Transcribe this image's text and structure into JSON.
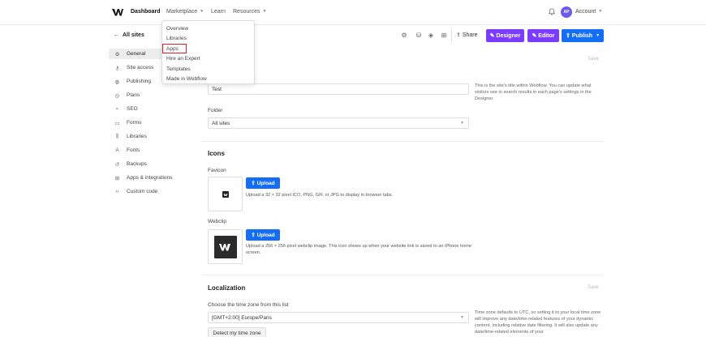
{
  "topnav": {
    "items": [
      {
        "label": "Dashboard",
        "active": true
      },
      {
        "label": "Marketplace",
        "has_caret": true
      },
      {
        "label": "Learn"
      },
      {
        "label": "Resources",
        "has_caret": true
      }
    ],
    "avatar_initials": "AP",
    "account_label": "Account"
  },
  "dropdown": {
    "items": [
      "Overview",
      "Libraries",
      "Apps",
      "Hire an Expert",
      "Templates",
      "Made in Webflow"
    ],
    "highlighted": "Apps",
    "highlight_color": "#d8242a"
  },
  "sidebar": {
    "back_label": "All sites",
    "items": [
      {
        "label": "General",
        "icon": "gear-icon",
        "active": true
      },
      {
        "label": "Site access",
        "icon": "key-icon"
      },
      {
        "label": "Publishing",
        "icon": "globe-icon"
      },
      {
        "label": "Plans",
        "icon": "plans-icon"
      },
      {
        "label": "SEO",
        "icon": "search-icon"
      },
      {
        "label": "Forms",
        "icon": "forms-icon"
      },
      {
        "label": "Libraries",
        "icon": "library-icon"
      },
      {
        "label": "Fonts",
        "icon": "font-icon"
      },
      {
        "label": "Backups",
        "icon": "backup-icon"
      },
      {
        "label": "Apps & integrations",
        "icon": "apps-icon"
      },
      {
        "label": "Custom code",
        "icon": "code-icon"
      }
    ]
  },
  "toolbar": {
    "share_label": "Share",
    "designer_label": "Designer",
    "editor_label": "Editor",
    "publish_label": "Publish",
    "colors": {
      "designer": "#7c3cff",
      "editor": "#7c3cff",
      "publish": "#146ef5"
    }
  },
  "overview": {
    "save_label": "Save",
    "name_value": "Test",
    "name_help": "This is the site's title within Webflow. You can update what visitors see in search results in each page's settings in the Designer.",
    "folder_label": "Folder",
    "folder_value": "All sites"
  },
  "icons": {
    "title": "Icons",
    "favicon_label": "Favicon",
    "favicon_upload_label": "Upload",
    "favicon_desc": "Upload a 32 × 32 pixel ICO, PNG, GIF, or JPG to display in browser tabs.",
    "webclip_label": "Webclip",
    "webclip_upload_label": "Upload",
    "webclip_desc": "Upload a 256 × 256 pixel webclip image. This icon shows up when your website link is saved to an iPhone home screen."
  },
  "localization": {
    "title": "Localization",
    "save_label": "Save",
    "timezone_label": "Choose the time zone from this list",
    "timezone_value": "[GMT+2:00] Europe/Paris",
    "timezone_help": "Time zone defaults to UTC, so setting it to your local time zone will improve any date/time-related features of your dynamic content, including relative date filtering. It will also update any date/time-related elements of your",
    "detect_label": "Detect my time zone"
  }
}
